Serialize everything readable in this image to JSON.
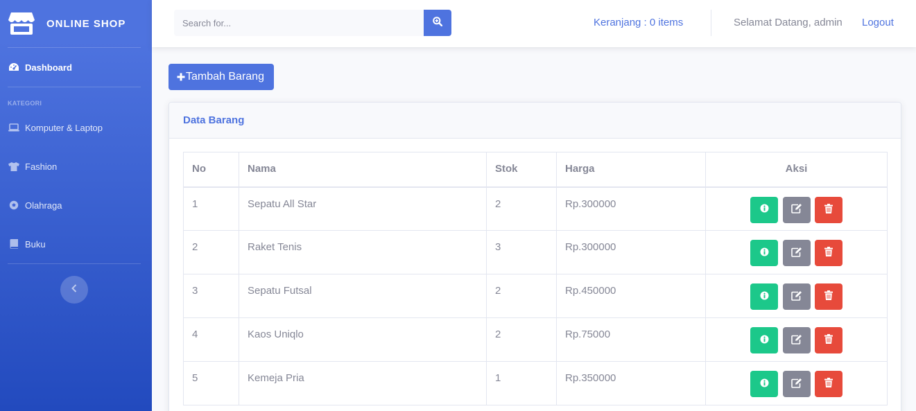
{
  "brand": {
    "name": "ONLINE SHOP",
    "icon": "store-icon"
  },
  "sidebar": {
    "dashboard": {
      "label": "Dashboard",
      "icon": "tachometer-icon"
    },
    "heading": "KATEGORI",
    "categories": [
      {
        "label": "Komputer & Laptop",
        "icon": "laptop-icon"
      },
      {
        "label": "Fashion",
        "icon": "tshirt-icon"
      },
      {
        "label": "Olahraga",
        "icon": "football-icon"
      },
      {
        "label": "Buku",
        "icon": "book-icon"
      }
    ],
    "toggle_icon": "chevron-left-icon"
  },
  "topbar": {
    "search_placeholder": "Search for...",
    "search_icon": "search-plus-icon",
    "cart": "Keranjang : 0 items",
    "welcome": "Selamat Datang, admin",
    "logout": "Logout"
  },
  "main": {
    "add_button": "Tambah Barang",
    "card_title": "Data Barang",
    "table": {
      "headers": [
        "No",
        "Nama",
        "Stok",
        "Harga",
        "Aksi"
      ],
      "rows": [
        {
          "no": "1",
          "nama": "Sepatu All Star",
          "stok": "2",
          "harga": "Rp.300000"
        },
        {
          "no": "2",
          "nama": "Raket Tenis",
          "stok": "3",
          "harga": "Rp.300000"
        },
        {
          "no": "3",
          "nama": "Sepatu Futsal",
          "stok": "2",
          "harga": "Rp.450000"
        },
        {
          "no": "4",
          "nama": "Kaos Uniqlo",
          "stok": "2",
          "harga": "Rp.75000"
        },
        {
          "no": "5",
          "nama": "Kemeja Pria",
          "stok": "1",
          "harga": "Rp.350000"
        }
      ]
    }
  },
  "colors": {
    "primary": "#4e73df",
    "success": "#1cc88a",
    "secondary": "#858796",
    "danger": "#e74a3b"
  }
}
